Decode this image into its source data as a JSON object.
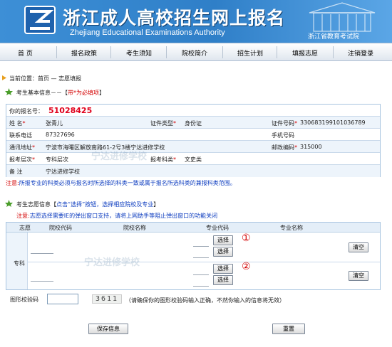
{
  "header": {
    "title": "浙江成人高校招生网上报名",
    "subtitle": "Zhejiang Educational Examinations Authority",
    "department": "浙江省教育考试院"
  },
  "nav": {
    "items": [
      "首  页",
      "报名政策",
      "考生须知",
      "院校简介",
      "招生计划",
      "填报志愿",
      "注销登录"
    ]
  },
  "breadcrumb": {
    "label": "当前位置：首页 — 志愿填报"
  },
  "basic_info": {
    "title": "考生基本信息－－【",
    "title_req": "带*为必填项",
    "title_end": "】",
    "reg_label": "你的报名号：",
    "reg_no": "51028425",
    "name_label": "姓  名",
    "name": "张青儿",
    "id_type_label": "证件类型",
    "id_type": "身份证",
    "id_no_label": "证件号码",
    "id_no": "330683199101036789",
    "phone_label": "联系电话",
    "phone": "87327696",
    "mobile_label": "手机号码",
    "address_label": "通讯地址",
    "address": "宁波市海曙区解放南路61-2号3楼宁达进修学校",
    "postcode_label": "邮政编码",
    "postcode": "315000",
    "level_label": "报考层次",
    "level": "专科层次",
    "subject_label": "报考科类",
    "subject": "文史类",
    "remark_label": "备  注",
    "remark": "宁达进修学校",
    "note_label": "注意",
    "note": "所报专业的科类必须与报名时所选择的科类一致或属于报名所选科类的兼报科类范围。"
  },
  "volunteer": {
    "title": "考生志愿信息【",
    "title_link": "点击“选择”按钮，选择相应院校及专业",
    "title_end": "】",
    "note_label": "注意",
    "note": "志愿选择需要IE的弹出窗口支持，请将上网助手等阻止弹出窗口的功能关闭",
    "headers": [
      "志愿",
      "院校代码",
      "院校名称",
      "专业代码",
      "专业名称"
    ],
    "row_label": "专科",
    "select_label": "选择",
    "clear_label": "清空",
    "mark1": "①",
    "mark2": "②"
  },
  "captcha": {
    "label": "图形校验码",
    "code": "3611",
    "hint": "（请确保你的图形校验码输入正确，不然你输入的信息将无效）"
  },
  "actions": {
    "save": "保存信息",
    "reset": "重置"
  },
  "watermark": "宁达进修学校",
  "colors": {
    "accent": "#2f7fc8",
    "required": "#d40000",
    "link": "#0b3bbf"
  }
}
